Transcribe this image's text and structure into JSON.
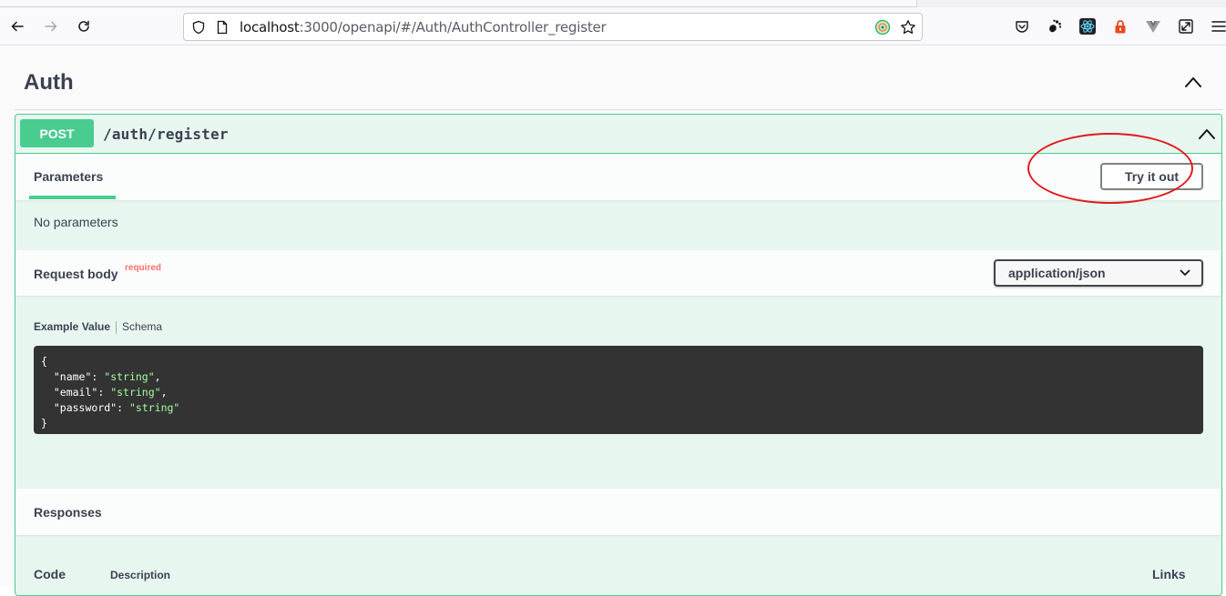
{
  "browser": {
    "url_host": "localhost",
    "url_rest": ":3000/openapi/#/Auth/AuthController_register"
  },
  "tag": {
    "title": "Auth"
  },
  "operation": {
    "method": "POST",
    "path": "/auth/register",
    "parameters_tab": "Parameters",
    "try_it_out_label": "Try it out",
    "no_parameters": "No parameters",
    "request_body": {
      "title": "Request body",
      "required_label": "required",
      "content_type": "application/json",
      "example_tab": "Example Value",
      "schema_tab": "Schema",
      "example": {
        "open": "{",
        "lines": [
          {
            "key": "\"name\"",
            "value": "\"string\"",
            "trail": ","
          },
          {
            "key": "\"email\"",
            "value": "\"string\"",
            "trail": ","
          },
          {
            "key": "\"password\"",
            "value": "\"string\"",
            "trail": ""
          }
        ],
        "close": "}"
      }
    },
    "responses": {
      "title": "Responses",
      "columns": {
        "code": "Code",
        "description": "Description",
        "links": "Links"
      }
    }
  },
  "colors": {
    "post_green": "#49cc90",
    "annotation_red": "#e01b1b",
    "code_bg": "#333333",
    "string_green": "#a2fca2"
  },
  "icons": [
    "back-icon",
    "forward-icon",
    "reload-icon",
    "shield-icon",
    "page-icon",
    "extension-badge-icon",
    "bookmark-star-icon",
    "pocket-icon",
    "gnome-extension-icon",
    "react-devtools-icon",
    "lock-extension-icon",
    "vue-devtools-icon",
    "screenshot-icon",
    "menu-icon",
    "chevron-up-icon",
    "chevron-down-icon"
  ]
}
